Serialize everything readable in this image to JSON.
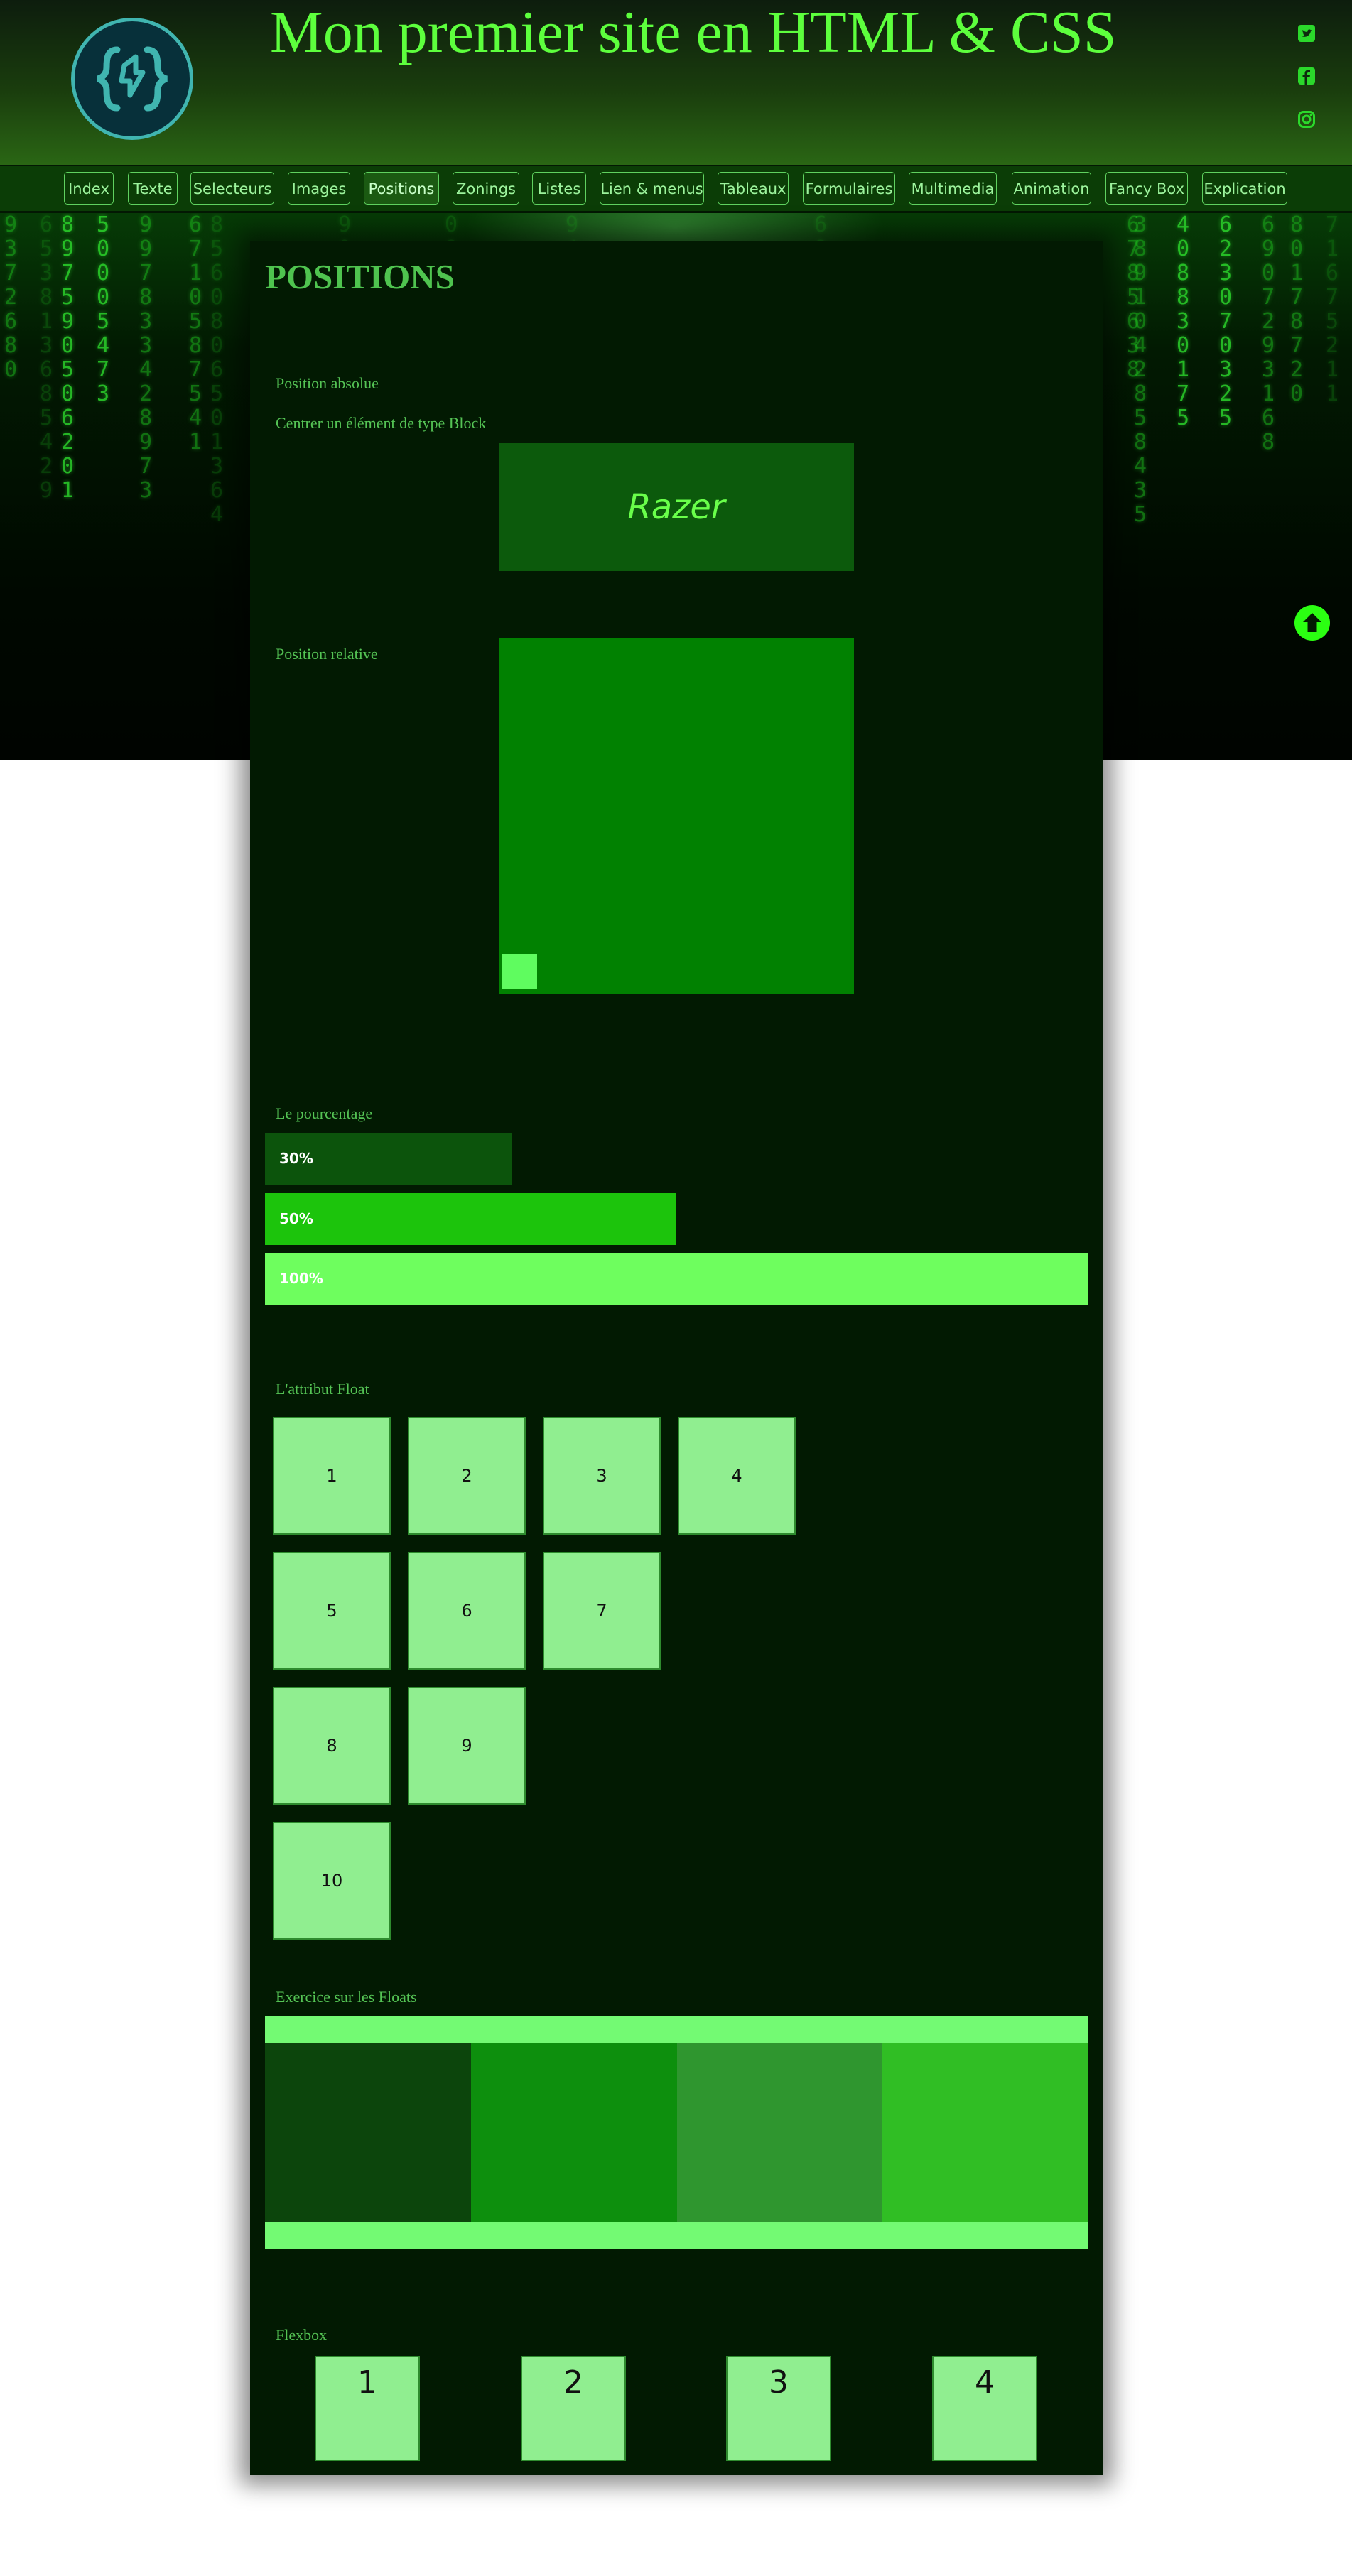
{
  "header": {
    "title": "Mon premier site en HTML & CSS",
    "logo_icon": "code-braces-logo-icon",
    "social_icons": [
      "twitter-icon",
      "facebook-icon",
      "instagram-icon"
    ]
  },
  "nav": {
    "items": [
      {
        "label": "Index"
      },
      {
        "label": "Texte"
      },
      {
        "label": "Selecteurs"
      },
      {
        "label": "Images"
      },
      {
        "label": "Positions",
        "active": true
      },
      {
        "label": "Zonings"
      },
      {
        "label": "Listes"
      },
      {
        "label": "Lien & menus"
      },
      {
        "label": "Tableaux"
      },
      {
        "label": "Formulaires"
      },
      {
        "label": "Multimedia"
      },
      {
        "label": "Animation"
      },
      {
        "label": "Fancy Box"
      },
      {
        "label": "Explication"
      }
    ]
  },
  "page": {
    "title": "POSITIONS"
  },
  "sections": {
    "absolute": {
      "label": "Position absolue",
      "sublabel": "Centrer un élément de type Block",
      "box_text": "Razer"
    },
    "relative": {
      "label": "Position relative"
    },
    "percentage": {
      "label": "Le pourcentage",
      "bars": [
        {
          "label": "30%",
          "value": 30,
          "color": "#0c540c"
        },
        {
          "label": "50%",
          "value": 50,
          "color": "#1cc40c"
        },
        {
          "label": "100%",
          "value": 100,
          "color": "#6efe5e"
        }
      ]
    },
    "float": {
      "label": "L'attribut Float",
      "boxes": [
        "1",
        "2",
        "3",
        "4",
        "5",
        "6",
        "7",
        "8",
        "9",
        "10"
      ]
    },
    "float_exercise": {
      "label": "Exercice sur les Floats",
      "colors": [
        "#0c450c",
        "#0d8f0d",
        "#2f962f",
        "#30be24"
      ],
      "band_color": "#73fa73"
    },
    "flexbox": {
      "label": "Flexbox",
      "boxes": [
        "1",
        "2",
        "3",
        "4"
      ]
    }
  },
  "scroll_top_icon": "arrow-up-circle-icon",
  "colors": {
    "accent": "#5dff3d",
    "panel": "#021a02",
    "nav_bg": "#0b3d06"
  }
}
